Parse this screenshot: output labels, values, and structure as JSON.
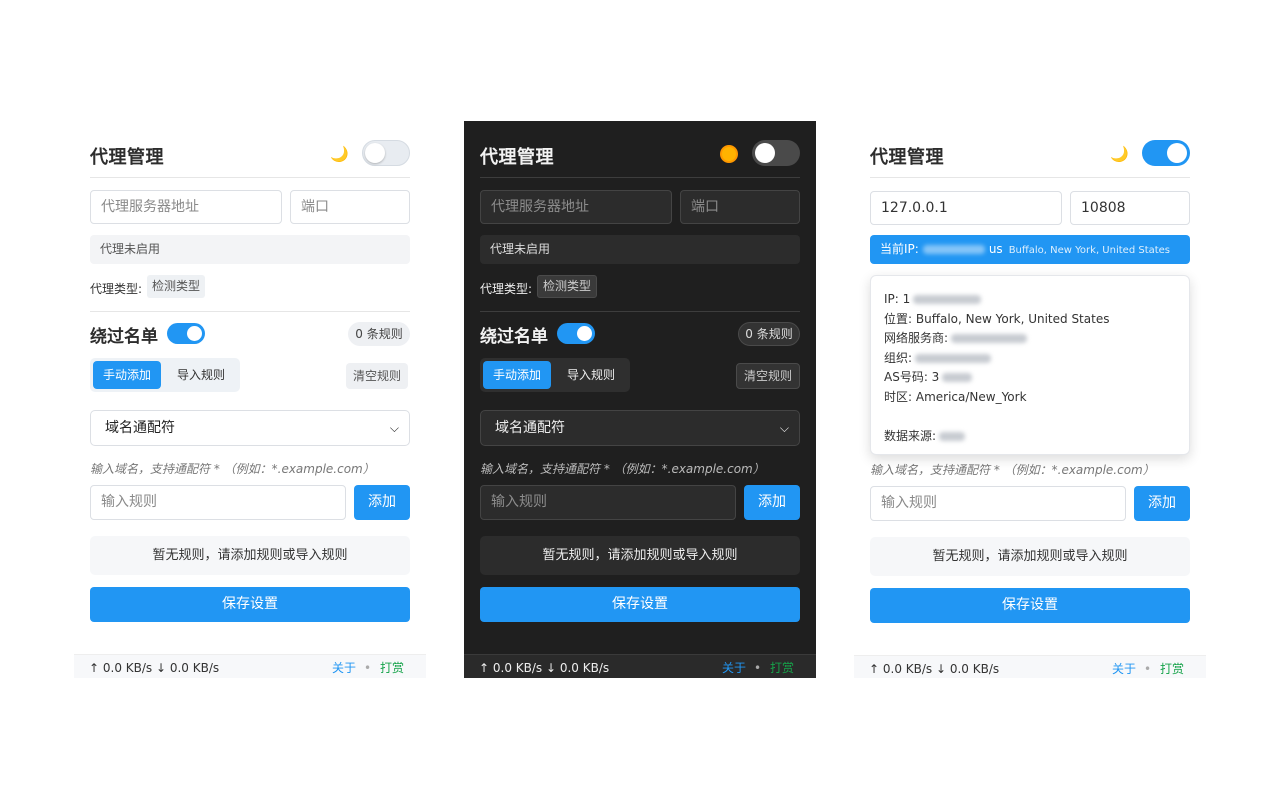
{
  "colors": {
    "accent": "#2196f3",
    "dark_bg": "#1f1f1f",
    "success": "#16a34a"
  },
  "panels": [
    {
      "theme": "light",
      "title": "代理管理",
      "theme_icon": "moon-icon",
      "theme_toggle": "off",
      "host_placeholder": "代理服务器地址",
      "port_placeholder": "端口",
      "status": "代理未启用",
      "type_label": "代理类型:",
      "type_button": "检测类型",
      "bypass_title": "绕过名单",
      "rule_count": "0 条规则",
      "tab_manual": "手动添加",
      "tab_import": "导入规则",
      "clear": "清空规则",
      "select_value": "域名通配符",
      "hint": "输入域名，支持通配符 * （例如：*.example.com）",
      "rule_placeholder": "输入规则",
      "add": "添加",
      "empty": "暂无规则，请添加规则或导入规则",
      "save": "保存设置",
      "speed": "↑ 0.0 KB/s ↓ 0.0 KB/s",
      "about": "关于",
      "sep": "•",
      "tip": "打赏"
    },
    {
      "theme": "dark",
      "title": "代理管理",
      "theme_icon": "sun-icon",
      "theme_toggle": "off",
      "host_placeholder": "代理服务器地址",
      "port_placeholder": "端口",
      "status": "代理未启用",
      "type_label": "代理类型:",
      "type_button": "检测类型",
      "bypass_title": "绕过名单",
      "rule_count": "0 条规则",
      "tab_manual": "手动添加",
      "tab_import": "导入规则",
      "clear": "清空规则",
      "select_value": "域名通配符",
      "hint": "输入域名，支持通配符 * （例如：*.example.com）",
      "rule_placeholder": "输入规则",
      "add": "添加",
      "empty": "暂无规则，请添加规则或导入规则",
      "save": "保存设置",
      "speed": "↑ 0.0 KB/s ↓ 0.0 KB/s",
      "about": "关于",
      "sep": "•",
      "tip": "打赏"
    },
    {
      "theme": "light",
      "title": "代理管理",
      "theme_icon": "moon-icon",
      "theme_toggle": "on",
      "host_value": "127.0.0.1",
      "port_value": "10808",
      "status_prefix": "当前IP:",
      "status_country": "us",
      "status_location": "Buffalo, New York, United States",
      "popup": {
        "ip_label": "IP: 1",
        "location": "位置: Buffalo, New York, United States",
        "isp_label": "网络服务商:",
        "org_label": "组织:",
        "as_label": "AS号码: 3",
        "timezone": "时区: America/New_York",
        "source_label": "数据来源:"
      },
      "hint": "输入域名，支持通配符 * （例如：*.example.com）",
      "rule_placeholder": "输入规则",
      "add": "添加",
      "empty": "暂无规则，请添加规则或导入规则",
      "save": "保存设置",
      "speed": "↑ 0.0 KB/s ↓ 0.0 KB/s",
      "about": "关于",
      "sep": "•",
      "tip": "打赏"
    }
  ]
}
